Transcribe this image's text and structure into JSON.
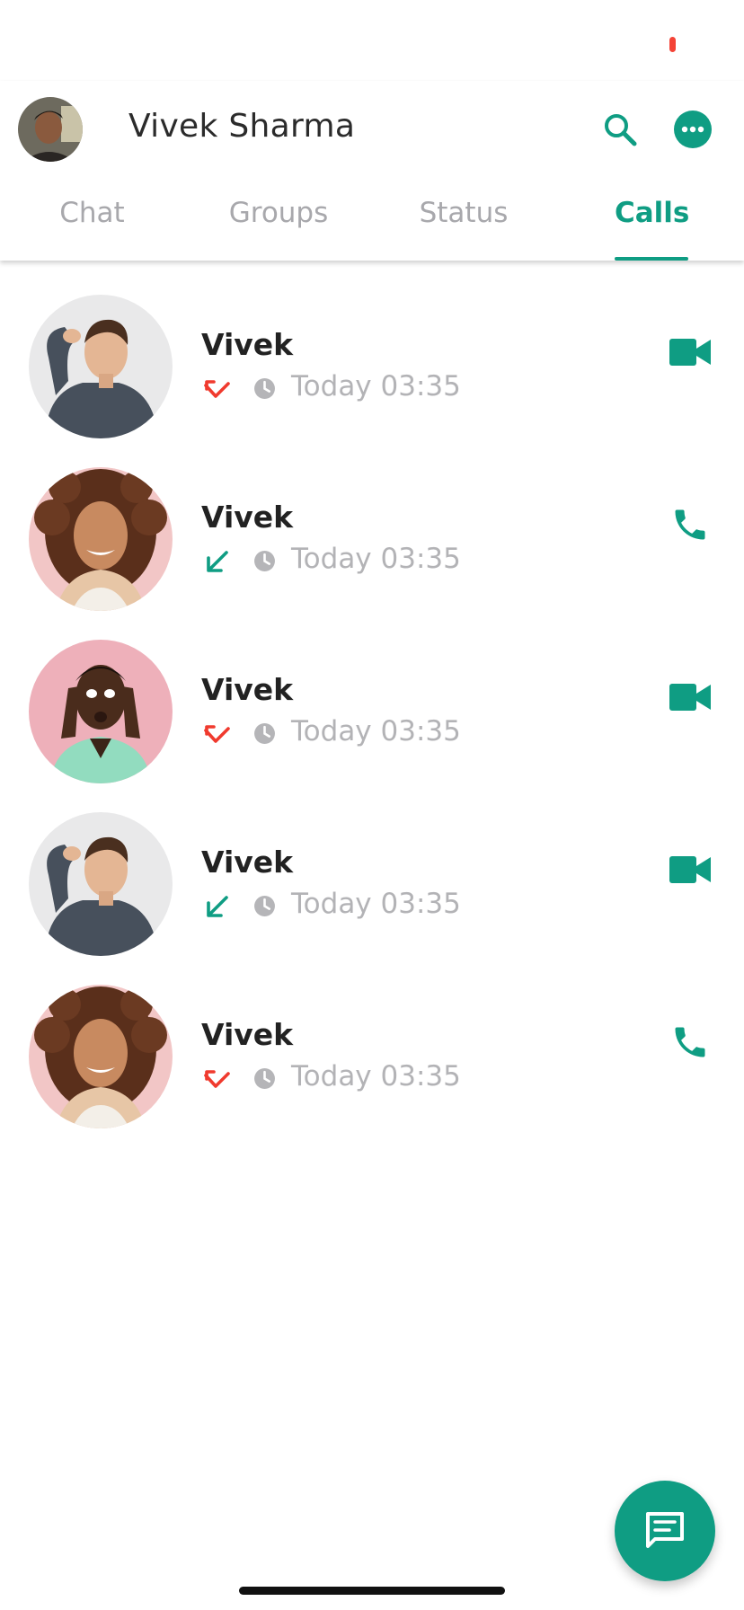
{
  "colors": {
    "accent": "#0F9D83",
    "missed": "#F03A2E",
    "recording": "#F44336"
  },
  "header": {
    "profile_name": "Vivek Sharma",
    "search_icon": "search-icon",
    "more_icon": "more-horizontal-icon"
  },
  "tabs": [
    {
      "label": "Chat",
      "active": false
    },
    {
      "label": "Groups",
      "active": false
    },
    {
      "label": "Status",
      "active": false
    },
    {
      "label": "Calls",
      "active": true
    }
  ],
  "calls": [
    {
      "name": "Vivek",
      "time": "Today 03:35",
      "direction": "missed",
      "type": "video",
      "avatar": "man-gray-shirt"
    },
    {
      "name": "Vivek",
      "time": "Today 03:35",
      "direction": "incoming",
      "type": "voice",
      "avatar": "woman-curly-hair"
    },
    {
      "name": "Vivek",
      "time": "Today 03:35",
      "direction": "missed",
      "type": "video",
      "avatar": "man-green-shirt"
    },
    {
      "name": "Vivek",
      "time": "Today 03:35",
      "direction": "incoming",
      "type": "video",
      "avatar": "man-gray-shirt"
    },
    {
      "name": "Vivek",
      "time": "Today 03:35",
      "direction": "missed",
      "type": "voice",
      "avatar": "woman-curly-hair"
    }
  ],
  "fab": {
    "icon": "new-chat-icon"
  }
}
